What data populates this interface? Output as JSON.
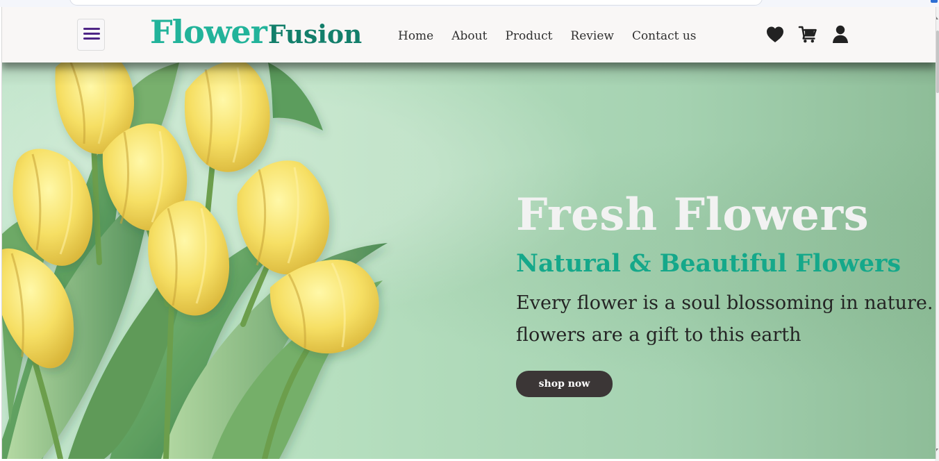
{
  "header": {
    "brand_primary": "Flower",
    "brand_secondary": "Fusion",
    "nav": [
      "Home",
      "About",
      "Product",
      "Review",
      "Contact us"
    ],
    "icons": [
      "heart-icon",
      "cart-icon",
      "user-icon"
    ]
  },
  "hero": {
    "title": "Fresh Flowers",
    "subtitle": "Natural & Beautiful Flowers",
    "line_1": "Every flower is a soul blossoming in nature.",
    "line_2": "flowers are a gift to this earth",
    "button_label": "shop now"
  },
  "colors": {
    "brand_teal": "#22b39a",
    "brand_dark_teal": "#137f6b",
    "menu_purple": "#4e2586",
    "hero_green": "#b6dfbf",
    "button_dark": "#3b3636"
  }
}
